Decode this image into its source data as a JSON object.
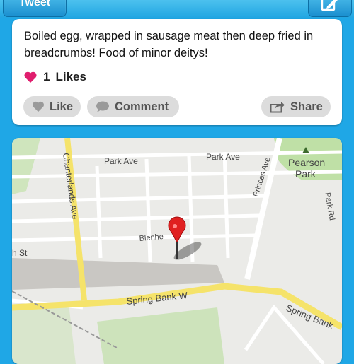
{
  "nav": {
    "back_label": "Tweet",
    "compose_icon": "compose-icon"
  },
  "post": {
    "text": "Boiled egg, wrapped in sausage meat then deep fried in breadcrumbs! Food of minor deitys!",
    "likes_count": "1",
    "likes_label": "Likes"
  },
  "actions": {
    "like_label": "Like",
    "comment_label": "Comment",
    "share_label": "Share"
  },
  "map": {
    "labels": {
      "park_ave_1": "Park Ave",
      "park_ave_2": "Park Ave",
      "chanterlands_ave": "Chanterlands Ave",
      "princes_ave": "Princes Ave",
      "pearson": "Pearson",
      "park": "Park",
      "park_rd": "Park Rd",
      "blenheim": "Blenhe",
      "st_fragment": "h St",
      "spring_bank_w": "Spring Bank W",
      "spring_bank": "Spring Bank"
    }
  },
  "colors": {
    "accent": "#1fa7e6",
    "heart": "#e01e6e",
    "pin": "#e02020",
    "road_major": "#f5e36a",
    "park_green": "#bfe0a6"
  }
}
